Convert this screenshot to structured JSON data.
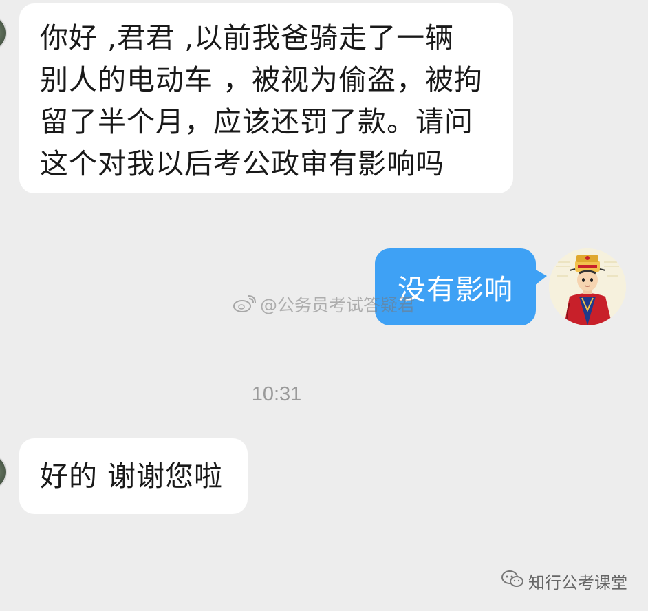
{
  "messages": {
    "incoming_1": "你好 ,君君 ,以前我爸骑走了一辆\n别人的电动车 ，被视为偷盗，被拘\n留了半个月，应该还罚了款。请问\n这个对我以后考公政审有影响吗",
    "outgoing_1": "没有影响",
    "incoming_2": "好的 谢谢您啦"
  },
  "timestamp": "10:31",
  "watermark": {
    "text": "@公务员考试答疑君",
    "icon": "weibo-icon"
  },
  "footer_watermark": {
    "text": "知行公考课堂",
    "icon": "wechat-icon"
  },
  "colors": {
    "background": "#ededed",
    "incoming_bubble": "#ffffff",
    "outgoing_bubble": "#3ea1f5",
    "timestamp": "#9a9a9a"
  }
}
